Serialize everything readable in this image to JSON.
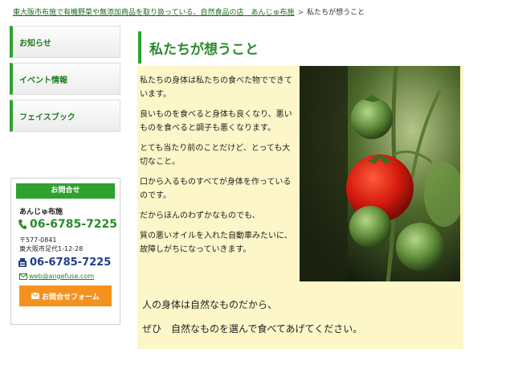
{
  "breadcrumb": {
    "home": "東大阪市布施で有機野菜や無添加商品を取り扱っている、自然食品の店　あんじゅ布施",
    "separator": ">",
    "current": "私たちが想うこと"
  },
  "sidebar": {
    "items": [
      {
        "label": "お知らせ"
      },
      {
        "label": "イベント情報"
      },
      {
        "label": "フェイスブック"
      }
    ]
  },
  "contact": {
    "header": "お問合せ",
    "store_name": "あんじゅ布施",
    "phone": "06-6785-7225",
    "postal": "〒577-0841",
    "address": "東大阪市足代1-12-28",
    "fax": "06-6785-7225",
    "email": "web@angefuse.com",
    "form_button": "お問合せフォーム"
  },
  "main": {
    "title": "私たちが想うこと",
    "paragraphs": [
      "私たちの身体は私たちの食べた物でできています。",
      "良いものを食べると身体も良くなり、悪いものを食べると調子も悪くなります。",
      "とても当たり前のことだけど、とっても大切なこと。",
      "口から入るものすべてが身体を作っているのです。",
      " だからほんのわずかなものでも、",
      "質の悪いオイルを入れた自動車みたいに、故障しがちになっていきます。"
    ],
    "closing": [
      "人の身体は自然なものだから、",
      "ぜひ　自然なものを選んで食べてあげてください。"
    ],
    "image_icon": "tomato-photo"
  },
  "colors": {
    "accent_green": "#2fa12f",
    "content_bg": "#fdf6c8",
    "form_button_orange": "#f5921e",
    "fax_blue": "#1f3f8a"
  }
}
